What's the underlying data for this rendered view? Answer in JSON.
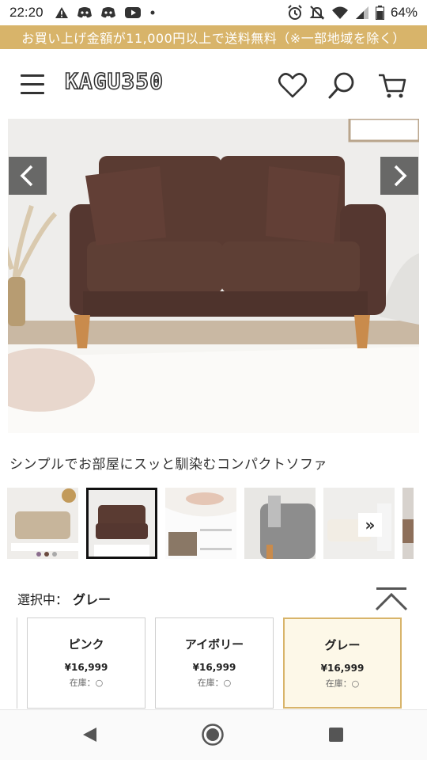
{
  "status_bar": {
    "time": "22:20",
    "battery": "64%",
    "left_icons": [
      "warning-icon",
      "discord-icon",
      "discord-icon",
      "youtube-icon",
      "dot-icon"
    ],
    "right_icons": [
      "alarm-icon",
      "mute-icon",
      "wifi-icon",
      "signal-icon",
      "battery-icon"
    ]
  },
  "promo": {
    "text": "お買い上げ金額が11,000円以上で送料無料（※一部地域を除く）",
    "color": "#d8b46a"
  },
  "header": {
    "logo": "KAGU350",
    "icons": [
      "menu-icon",
      "heart-icon",
      "search-icon",
      "cart-icon"
    ]
  },
  "product": {
    "title": "シンプルでお部屋にスッと馴染むコンパクトソファ",
    "main_image": "brown two-seat fabric sofa with cushions",
    "thumbnails": [
      {
        "name": "beige-sofa-colors",
        "active": false
      },
      {
        "name": "brown-sofa",
        "active": true
      },
      {
        "name": "fabric-detail",
        "active": false
      },
      {
        "name": "armrest-detail",
        "active": false
      },
      {
        "name": "white-sofa-room",
        "active": false,
        "more_icon": "»"
      },
      {
        "name": "partial",
        "active": false
      }
    ]
  },
  "selection": {
    "label": "選択中：",
    "value": "グレー"
  },
  "variants": [
    {
      "name": "ピンク",
      "price": "¥16,999",
      "stock": "在庫：○",
      "selected": false
    },
    {
      "name": "アイボリー",
      "price": "¥16,999",
      "stock": "在庫：○",
      "selected": false
    },
    {
      "name": "グレー",
      "price": "¥16,999",
      "stock": "在庫：○",
      "selected": true
    }
  ],
  "navbar": {
    "icons": [
      "back-icon",
      "home-icon",
      "recents-icon"
    ]
  }
}
